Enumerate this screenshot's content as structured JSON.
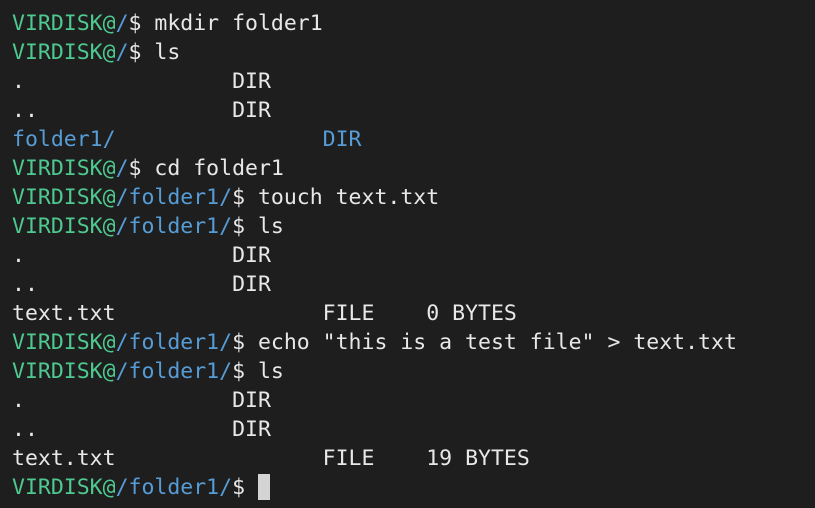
{
  "colors": {
    "background": "#1e1e1e",
    "host": "#4ec98f",
    "path": "#569cd6",
    "text": "#e8e8e8",
    "dir_entry": "#569cd6",
    "cursor": "#d4d4d4"
  },
  "terminal": {
    "prompt_host": "VIRDISK@",
    "root_path": "/",
    "folder_path": "/folder1/",
    "prompt_symbol": "$ ",
    "commands": [
      "mkdir folder1",
      "ls",
      "cd folder1",
      "touch text.txt",
      "ls",
      "echo \"this is a test file\" > text.txt",
      "ls"
    ],
    "listing1": [
      {
        "name": ".                ",
        "type": "DIR"
      },
      {
        "name": "..               ",
        "type": "DIR"
      },
      {
        "name": "folder1/                ",
        "type": "DIR"
      }
    ],
    "listing2": [
      {
        "name": ".                ",
        "type": "DIR"
      },
      {
        "name": "..               ",
        "type": "DIR"
      },
      {
        "name": "text.txt                ",
        "type": "FILE    ",
        "size": "0 BYTES"
      }
    ],
    "listing3": [
      {
        "name": ".                ",
        "type": "DIR"
      },
      {
        "name": "..               ",
        "type": "DIR"
      },
      {
        "name": "text.txt                ",
        "type": "FILE    ",
        "size": "19 BYTES"
      }
    ]
  }
}
